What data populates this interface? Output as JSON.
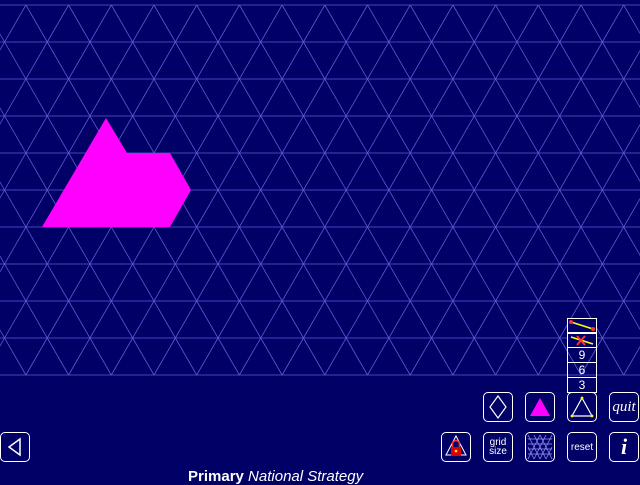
{
  "colors": {
    "background": "#000066",
    "grid": "#5b5bd6",
    "shape": "#ff00ff",
    "button_border": "#ffffff"
  },
  "shape": {
    "name": "pink polygon",
    "color": "#ff00ff"
  },
  "toolbar": {
    "grid_size_label": "grid size",
    "reset_label": "reset",
    "quit_label": "quit",
    "info_label": "i",
    "rhombus_icon": "rhombus-icon",
    "fill_triangle_icon": "filled-triangle-icon",
    "outline_triangle_icon": "outline-triangle-icon",
    "lock_icon": "lock-icon",
    "grid_pattern_icon": "triangle-grid-icon",
    "back_icon": "back-arrow-icon"
  },
  "number_options": [
    "9",
    "6",
    "3"
  ],
  "footer": {
    "brand_bold": "Primary",
    "brand_italic": "National Strategy"
  }
}
